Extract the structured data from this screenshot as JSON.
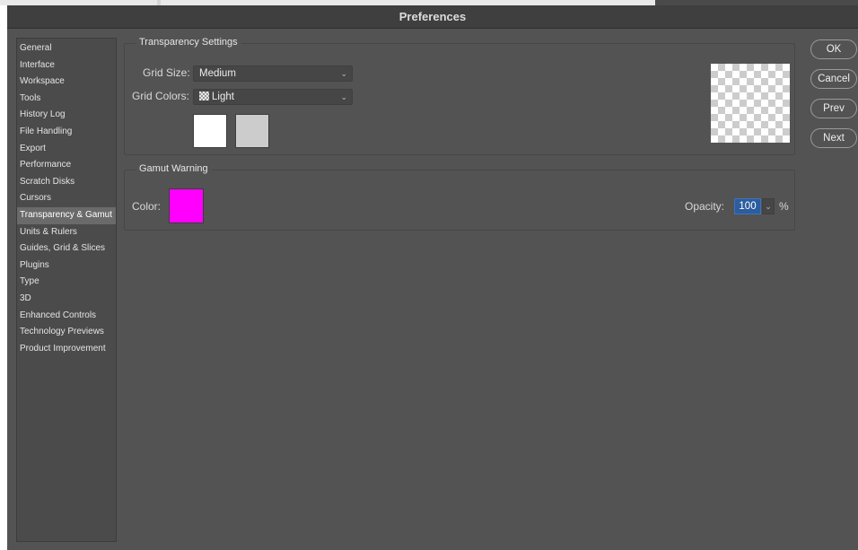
{
  "window": {
    "title": "Preferences"
  },
  "sidebar": {
    "items": [
      {
        "label": "General"
      },
      {
        "label": "Interface"
      },
      {
        "label": "Workspace"
      },
      {
        "label": "Tools"
      },
      {
        "label": "History Log"
      },
      {
        "label": "File Handling"
      },
      {
        "label": "Export"
      },
      {
        "label": "Performance"
      },
      {
        "label": "Scratch Disks"
      },
      {
        "label": "Cursors"
      },
      {
        "label": "Transparency & Gamut"
      },
      {
        "label": "Units & Rulers"
      },
      {
        "label": "Guides, Grid & Slices"
      },
      {
        "label": "Plugins"
      },
      {
        "label": "Type"
      },
      {
        "label": "3D"
      },
      {
        "label": "Enhanced Controls"
      },
      {
        "label": "Technology Previews"
      },
      {
        "label": "Product Improvement"
      }
    ],
    "active": "Transparency & Gamut"
  },
  "transparency": {
    "title": "Transparency Settings",
    "grid_size_label": "Grid Size:",
    "grid_size_value": "Medium",
    "grid_colors_label": "Grid Colors:",
    "grid_colors_value": "Light",
    "swatch1_color": "#ffffff",
    "swatch2_color": "#cccccc"
  },
  "gamut": {
    "title": "Gamut Warning",
    "color_label": "Color:",
    "color_value": "#ff00ff",
    "opacity_label": "Opacity:",
    "opacity_value": "100",
    "opacity_unit": "%"
  },
  "buttons": {
    "ok": "OK",
    "cancel": "Cancel",
    "prev": "Prev",
    "next": "Next"
  },
  "icons": {
    "grid_colors_icon": "checkerboard-icon",
    "dropdown_icon": "chevron-down-icon"
  }
}
